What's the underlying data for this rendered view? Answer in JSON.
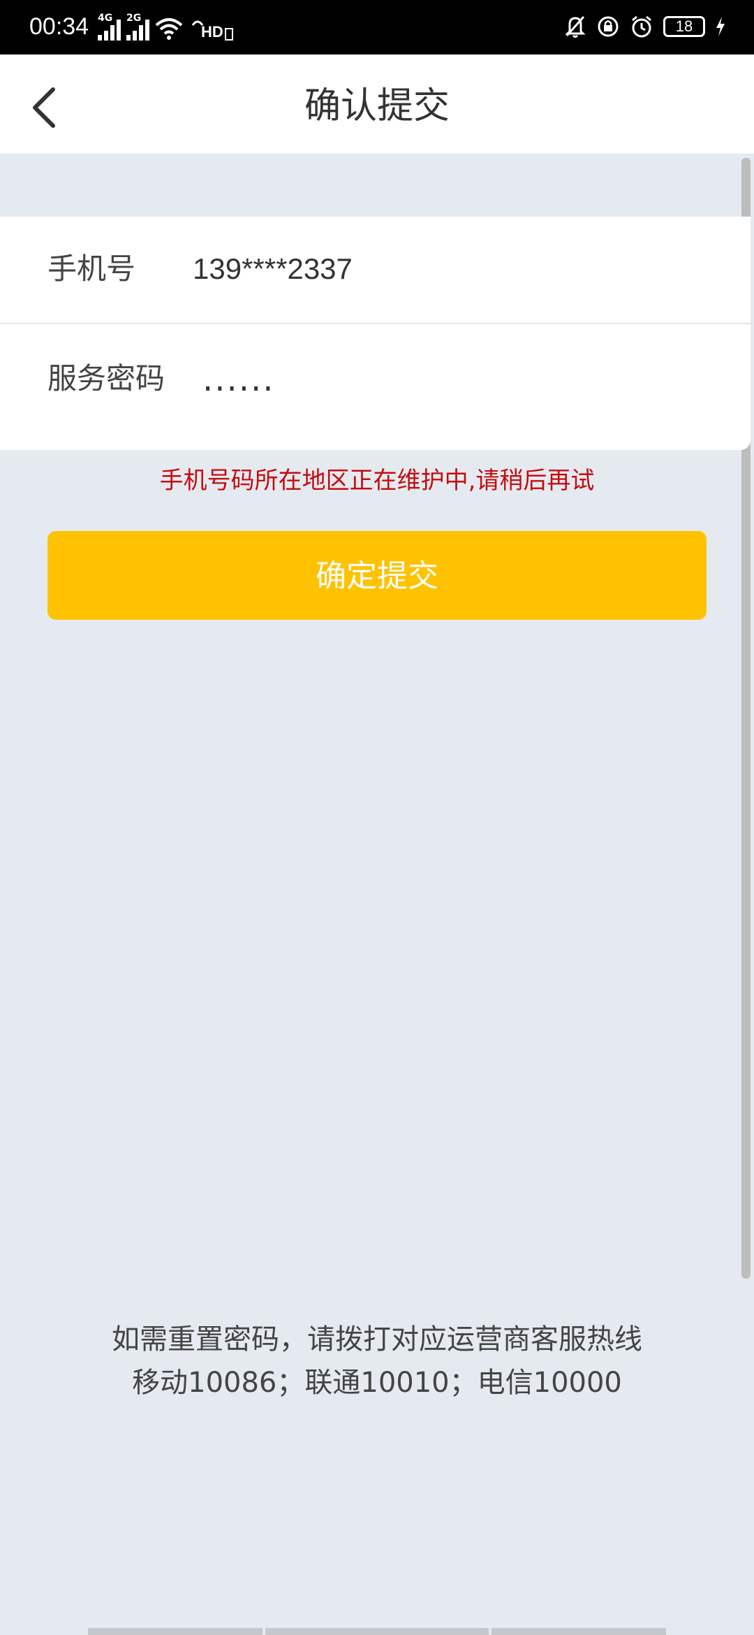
{
  "status_bar": {
    "time": "00:34",
    "network_1": "4G",
    "network_2": "2G",
    "hd_badge": "HD",
    "battery_level": "18",
    "icons": [
      "signal-4g-icon",
      "signal-2g-icon",
      "wifi-icon",
      "hd-voice-icon",
      "mute-bell-icon",
      "lock-rotation-icon",
      "alarm-icon",
      "battery-icon",
      "charging-icon"
    ]
  },
  "header": {
    "title": "确认提交",
    "back_icon": "chevron-left-icon"
  },
  "form": {
    "phone_label": "手机号",
    "phone_value": "139****2337",
    "password_label": "服务密码",
    "password_value": "......"
  },
  "error_message": "手机号码所在地区正在维护中,请稍后再试",
  "submit_label": "确定提交",
  "help": {
    "line1": "如需重置密码，请拨打对应运营商客服热线",
    "line2": "移动10086；联通10010；电信10000"
  },
  "colors": {
    "accent": "#ffc200",
    "error": "#c40d0d",
    "background": "#e5eaf1"
  }
}
